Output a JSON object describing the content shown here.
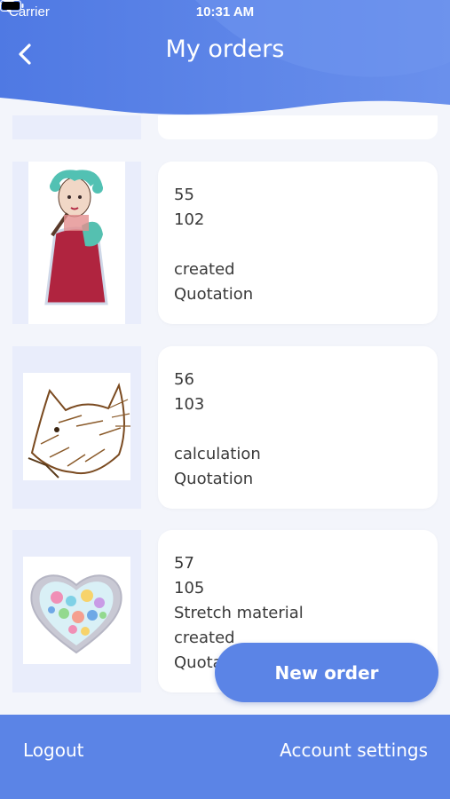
{
  "status_bar": {
    "carrier": "Carrier",
    "time": "10:31 AM"
  },
  "header": {
    "title": "My orders",
    "back_icon": "chevron-left-icon"
  },
  "orders": [
    {
      "lines": [
        "55",
        "102",
        "",
        "created",
        "Quotation"
      ],
      "image": "embroidered-figure"
    },
    {
      "lines": [
        "56",
        "103",
        "",
        "calculation",
        "Quotation"
      ],
      "image": "embroidered-fox"
    },
    {
      "lines": [
        "57",
        "105",
        "Stretch material",
        "created",
        "Quotation"
      ],
      "image": "embroidered-heart"
    }
  ],
  "new_order_label": "New order",
  "bottom_bar": {
    "logout_label": "Logout",
    "account_settings_label": "Account settings"
  },
  "colors": {
    "primary": "#5b84e6",
    "thumb_bg": "#e9edfb",
    "page_bg": "#f3f5fb"
  }
}
